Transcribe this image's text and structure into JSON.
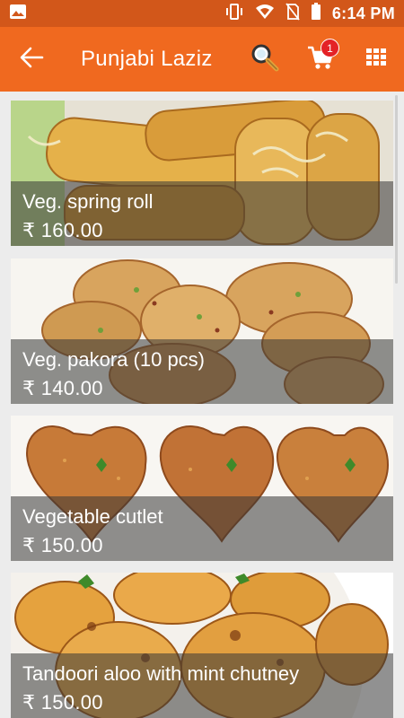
{
  "status_bar": {
    "time": "6:14 PM"
  },
  "app_bar": {
    "title": "Punjabi Laziz",
    "cart_count": "1"
  },
  "items": [
    {
      "name": "Veg. spring roll",
      "price": "₹ 160.00"
    },
    {
      "name": "Veg. pakora (10 pcs)",
      "price": "₹ 140.00"
    },
    {
      "name": "Vegetable cutlet",
      "price": "₹ 150.00"
    },
    {
      "name": "Tandoori aloo with mint chutney",
      "price": "₹ 150.00"
    }
  ],
  "colors": {
    "status_bar": "#d2571a",
    "app_bar": "#f0691f",
    "badge": "#e42226"
  },
  "icons": [
    "image-icon",
    "vibrate-icon",
    "wifi-icon",
    "no-sim-icon",
    "battery-icon",
    "back-arrow-icon",
    "search-icon",
    "cart-icon",
    "grid-view-icon"
  ]
}
